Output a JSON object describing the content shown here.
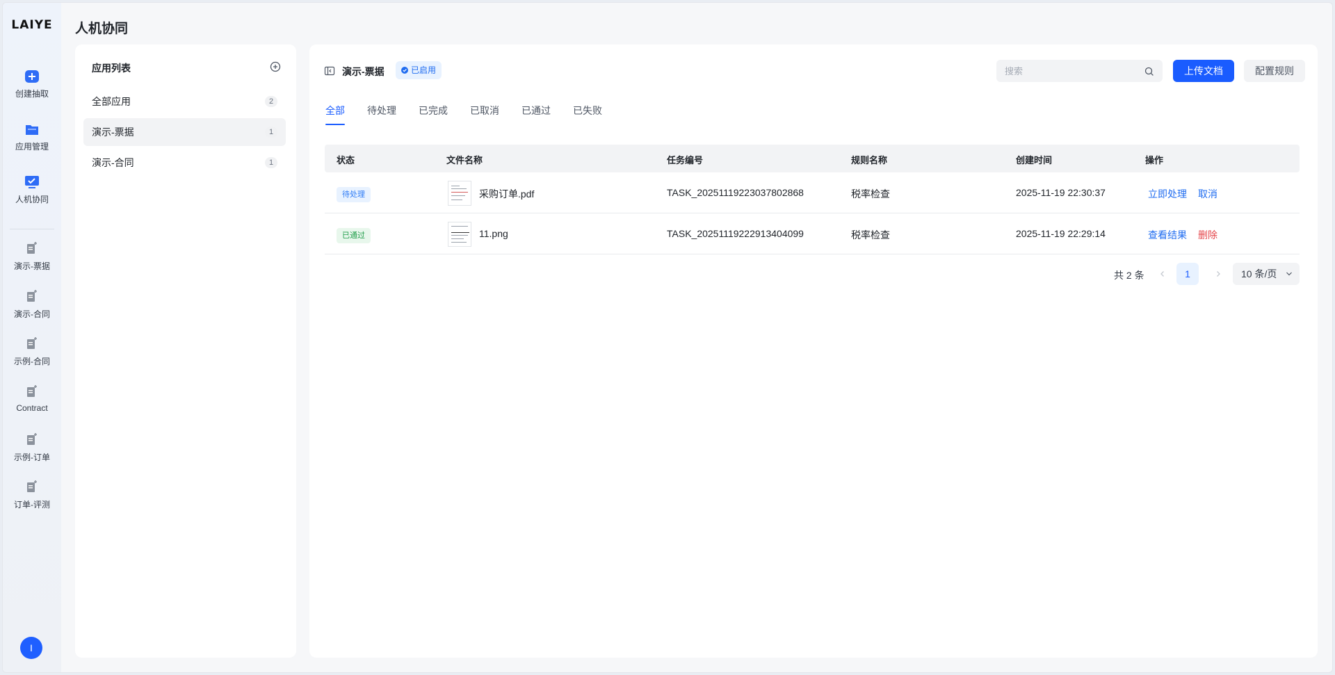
{
  "brand": {
    "logo_text": "LAIYE"
  },
  "rail": {
    "items": [
      {
        "label": "创建抽取",
        "icon": "plus-badge-icon"
      },
      {
        "label": "应用管理",
        "icon": "folder-icon"
      },
      {
        "label": "人机协同",
        "icon": "monitor-check-icon"
      }
    ],
    "apps": [
      {
        "label": "演示-票据",
        "icon": "doc-edit-icon"
      },
      {
        "label": "演示-合同",
        "icon": "doc-edit-icon"
      },
      {
        "label": "示例-合同",
        "icon": "doc-edit-icon"
      },
      {
        "label": "Contract",
        "icon": "doc-edit-icon"
      },
      {
        "label": "示例-订单",
        "icon": "doc-edit-icon"
      },
      {
        "label": "订单-评测",
        "icon": "doc-edit-icon"
      }
    ],
    "avatar_text": "I"
  },
  "page": {
    "title": "人机协同"
  },
  "app_list": {
    "header": "应用列表",
    "items": [
      {
        "label": "全部应用",
        "count": "2"
      },
      {
        "label": "演示-票据",
        "count": "1"
      },
      {
        "label": "演示-合同",
        "count": "1"
      }
    ]
  },
  "main": {
    "title": "演示-票据",
    "status": "已启用",
    "search_placeholder": "搜索",
    "upload_label": "上传文档",
    "config_label": "配置规则",
    "tabs": [
      "全部",
      "待处理",
      "已完成",
      "已取消",
      "已通过",
      "已失败"
    ],
    "active_tab": "全部",
    "columns": [
      "状态",
      "文件名称",
      "任务编号",
      "规则名称",
      "创建时间",
      "操作"
    ],
    "rows": [
      {
        "status": "待处理",
        "file": "采购订单.pdf",
        "task_id": "TASK_20251119223037802868",
        "rule": "税率检查",
        "created": "2025-11-19 22:30:37",
        "action1": "立即处理",
        "action2": "取消"
      },
      {
        "status": "已通过",
        "file": "11.png",
        "task_id": "TASK_20251119222913404099",
        "rule": "税率检查",
        "created": "2025-11-19 22:29:14",
        "action1": "查看结果",
        "action2": "删除"
      }
    ],
    "pager": {
      "total": "共 2 条",
      "page": "1",
      "page_size": "10 条/页"
    }
  },
  "colors": {
    "primary": "#1a5cff",
    "danger": "#e5484d",
    "success": "#1f9d49"
  }
}
